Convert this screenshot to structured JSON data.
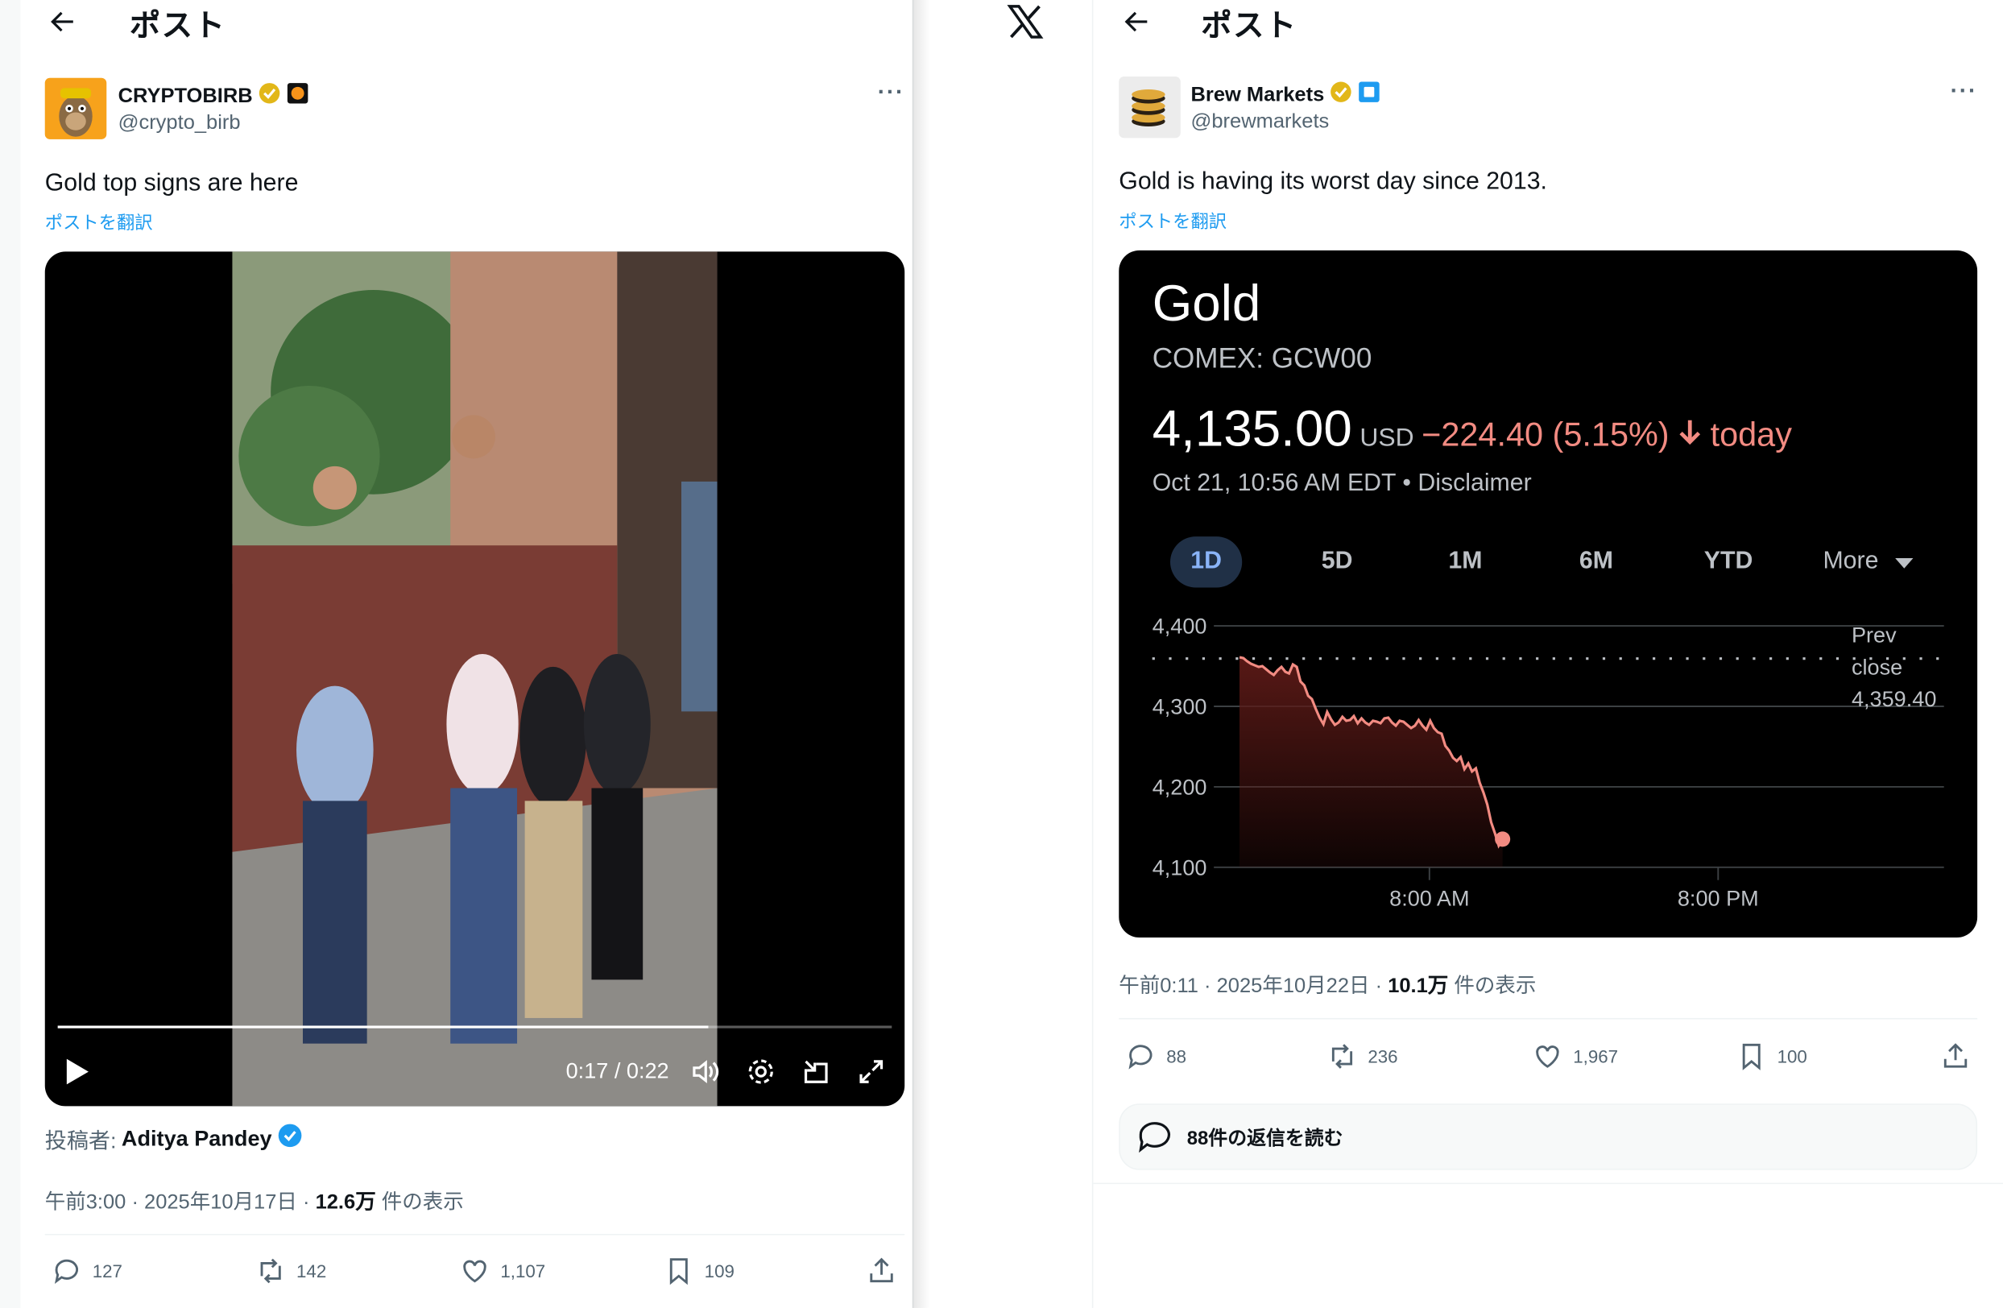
{
  "left_post": {
    "header_title": "ポスト",
    "author": {
      "display_name": "CRYPTOBIRB",
      "handle": "@crypto_birb"
    },
    "text": "Gold top signs are here",
    "translate": "ポストを翻訳",
    "video": {
      "time": "0:17 / 0:22",
      "progress": 0.78
    },
    "poster_prefix": "投稿者:",
    "poster_name": "Aditya Pandey",
    "meta_time": "午前3:00 · 2025年10月17日 · ",
    "meta_views": "12.6万",
    "meta_views_suffix": " 件の表示",
    "actions": {
      "replies": "127",
      "reposts": "142",
      "likes": "1,107",
      "bookmarks": "109"
    }
  },
  "right_post": {
    "header_title": "ポスト",
    "author": {
      "display_name": "Brew Markets",
      "handle": "@brewmarkets"
    },
    "text": "Gold is having its worst day since 2013.",
    "translate": "ポストを翻訳",
    "meta_time": "午前0:11 · 2025年10月22日 · ",
    "meta_views": "10.1万",
    "meta_views_suffix": " 件の表示",
    "actions": {
      "replies": "88",
      "reposts": "236",
      "likes": "1,967",
      "bookmarks": "100"
    },
    "read_replies": "88件の返信を読む"
  },
  "gold_card": {
    "title": "Gold",
    "ticker": "COMEX: GCW00",
    "price": "4,135.00",
    "currency": "USD",
    "change": "−224.40 (5.15%)",
    "change_suffix": "today",
    "timestamp": "Oct 21, 10:56 AM EDT • Disclaimer",
    "ranges": [
      "1D",
      "5D",
      "1M",
      "6M",
      "YTD",
      "More"
    ],
    "selected_range": "1D"
  },
  "chart_data": {
    "type": "area",
    "y_ticks": [
      "4,400",
      "4,300",
      "4,200",
      "4,100"
    ],
    "ylim": [
      4100,
      4400
    ],
    "x_ticks": [
      "8:00 AM",
      "8:00 PM"
    ],
    "prev_close_label": [
      "Prev",
      "close",
      "4,359.40"
    ],
    "prev_close": 4359.4,
    "series": [
      {
        "values": [
          4361,
          4360,
          4356,
          4353,
          4351,
          4349,
          4350,
          4346,
          4342,
          4339,
          4345,
          4349,
          4343,
          4341,
          4352,
          4349,
          4331,
          4326,
          4313,
          4309,
          4297,
          4286,
          4278,
          4293,
          4284,
          4277,
          4280,
          4287,
          4282,
          4283,
          4288,
          4279,
          4285,
          4280,
          4277,
          4282,
          4281,
          4279,
          4285,
          4286,
          4280,
          4276,
          4282,
          4281,
          4277,
          4273,
          4276,
          4283,
          4276,
          4271,
          4282,
          4273,
          4268,
          4266,
          4251,
          4245,
          4236,
          4232,
          4237,
          4222,
          4229,
          4219,
          4223,
          4205,
          4193,
          4178,
          4156,
          4142,
          4127,
          4135
        ]
      }
    ],
    "colors": {
      "line": "#f28b82",
      "fill_top": "#5c1a17",
      "grid": "#3c4043",
      "text": "#bdc1c6"
    }
  }
}
